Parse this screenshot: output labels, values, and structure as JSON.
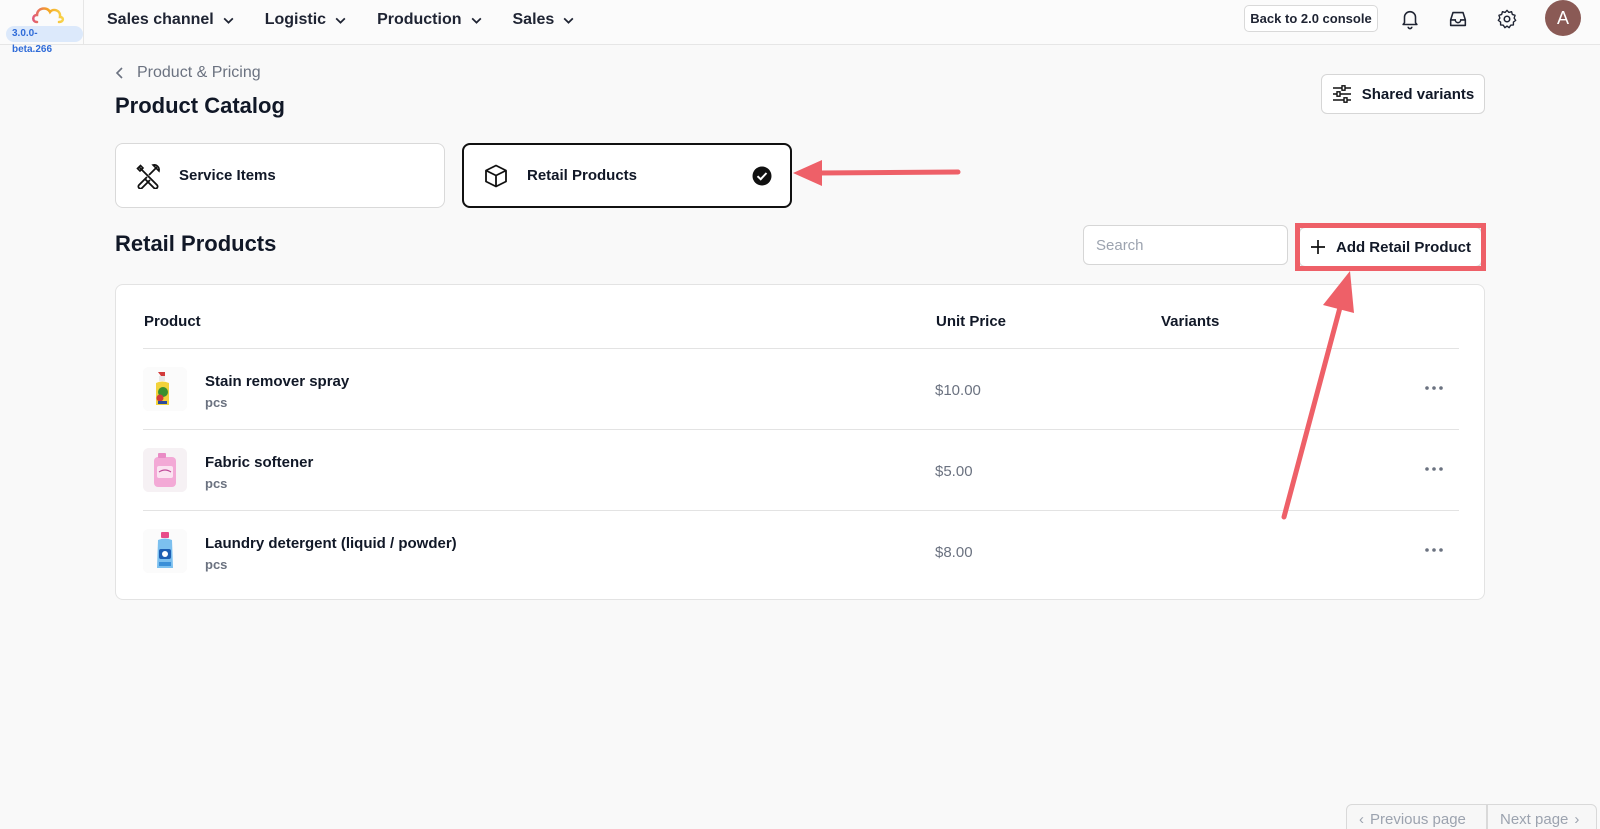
{
  "app": {
    "version": "3.0.0-beta.266"
  },
  "nav": {
    "items": [
      {
        "label": "Sales channel"
      },
      {
        "label": "Logistic"
      },
      {
        "label": "Production"
      },
      {
        "label": "Sales"
      }
    ],
    "back_button": "Back to 2.0 console",
    "icons": [
      "bell-icon",
      "inbox-icon",
      "gear-icon"
    ],
    "avatar_initial": "A"
  },
  "header": {
    "breadcrumb": "Product & Pricing",
    "title": "Product Catalog",
    "shared_variants_label": "Shared variants"
  },
  "tabs": [
    {
      "label": "Service Items",
      "icon": "tools-icon",
      "selected": false
    },
    {
      "label": "Retail Products",
      "icon": "box-icon",
      "selected": true
    }
  ],
  "section": {
    "title": "Retail Products",
    "search_placeholder": "Search",
    "add_button_label": "Add Retail Product"
  },
  "table": {
    "columns": [
      "Product",
      "Unit Price",
      "Variants"
    ],
    "rows": [
      {
        "name": "Stain remover spray",
        "unit": "pcs",
        "price": "$10.00",
        "variants": ""
      },
      {
        "name": "Fabric softener",
        "unit": "pcs",
        "price": "$5.00",
        "variants": ""
      },
      {
        "name": "Laundry detergent (liquid / powder)",
        "unit": "pcs",
        "price": "$8.00",
        "variants": ""
      }
    ]
  },
  "pagination": {
    "prev_label": "Previous page",
    "next_label": "Next page"
  },
  "colors": {
    "annotation": "#ee6068",
    "version_bg": "#dce9fb",
    "version_text": "#2f6bd8",
    "avatar": "#8a5a55"
  }
}
